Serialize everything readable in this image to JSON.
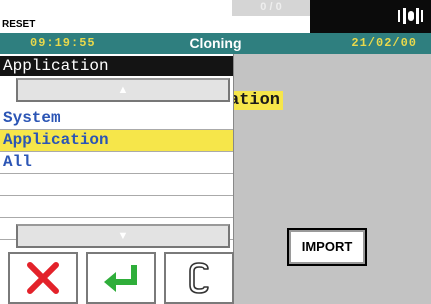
{
  "topbar": {
    "reset_label": "RESET",
    "center_value": "0 / 0",
    "signal_icon": "signal-icon"
  },
  "header": {
    "time": "09:19:55",
    "title": "Cloning",
    "date": "21/02/00"
  },
  "main": {
    "background_label": "ation",
    "import_label": "IMPORT"
  },
  "panel": {
    "title": "Application",
    "up_arrow_icon": "arrow-up-icon",
    "down_arrow_icon": "arrow-down-icon",
    "items": [
      {
        "label": "System",
        "selected": false
      },
      {
        "label": "Application",
        "selected": true
      },
      {
        "label": "All",
        "selected": false
      },
      {
        "label": "",
        "selected": false
      },
      {
        "label": "",
        "selected": false
      },
      {
        "label": "",
        "selected": false
      }
    ],
    "actions": {
      "cancel_icon": "cancel-icon",
      "enter_icon": "enter-icon",
      "clear_icon": "clear-c-icon"
    }
  },
  "colors": {
    "header_bg": "#2f7f7f",
    "header_text": "#e8d84c",
    "highlight": "#f6e64a",
    "list_text": "#2b55b5",
    "cancel_red": "#e3222a",
    "enter_green": "#2fae3a"
  }
}
